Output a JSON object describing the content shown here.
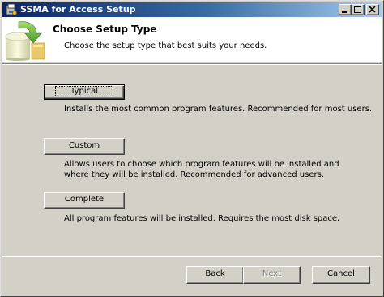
{
  "window": {
    "title": "SSMA for Access Setup"
  },
  "titlebar": {
    "minimize_icon": "minimize-icon",
    "maximize_icon": "maximize-icon",
    "close_icon": "close-icon"
  },
  "banner": {
    "title": "Choose Setup Type",
    "subtitle": "Choose the setup type that best suits your needs.",
    "icon": "setup-disk-icon"
  },
  "options": [
    {
      "label": "Typical",
      "mnemonic": "T",
      "description": "Installs the most common program features. Recommended for most users."
    },
    {
      "label": "Custom",
      "mnemonic": "u",
      "description": "Allows users to choose which program features will be installed and where they will be installed. Recommended for advanced users."
    },
    {
      "label": "Complete",
      "mnemonic": "o",
      "description": "All program features will be installed. Requires the most disk space."
    }
  ],
  "footer": {
    "back_label": "Back",
    "next_label": "Next",
    "cancel_label": "Cancel"
  },
  "colors": {
    "dialog_bg": "#d4d0c8",
    "titlebar_start": "#0a246a",
    "titlebar_end": "#a6caf0",
    "banner_bg": "#ffffff"
  }
}
